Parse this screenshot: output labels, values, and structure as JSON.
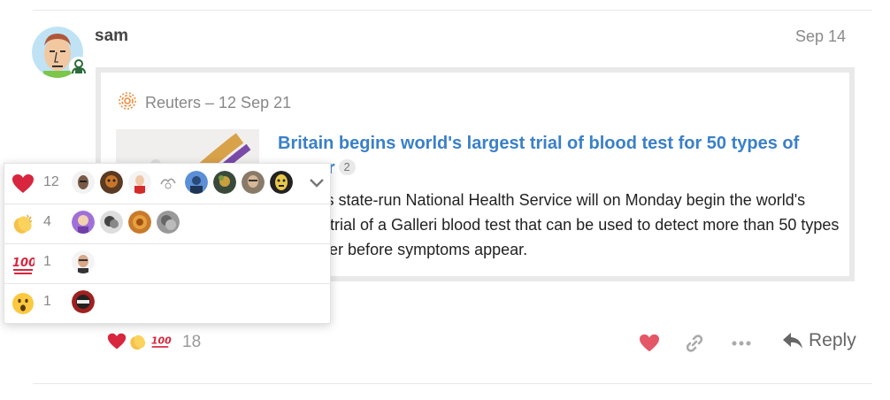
{
  "post": {
    "username": "sam",
    "date": "Sep 14"
  },
  "onebox": {
    "source": "Reuters – 12 Sep 21",
    "title": "Britain begins world's largest trial of blood test for 50 types of cancer",
    "link_count": "2",
    "excerpt": "Britain's state-run National Health Service will on Monday begin the world's largest trial of a Galleri blood test that can be used to detect more than 50 types of cancer before symptoms appear."
  },
  "reactions": [
    {
      "emoji": "heart",
      "count": "12",
      "users": [
        "u1",
        "u2",
        "u3",
        "u4",
        "u5",
        "u6",
        "u7",
        "u8"
      ]
    },
    {
      "emoji": "clap",
      "count": "4",
      "users": [
        "u9",
        "u10",
        "u11",
        "u12"
      ]
    },
    {
      "emoji": "100",
      "count": "1",
      "users": [
        "u13"
      ]
    },
    {
      "emoji": "open_mouth",
      "count": "1",
      "users": [
        "u14"
      ]
    }
  ],
  "summary": {
    "total": "18"
  },
  "controls": {
    "reply_label": "Reply"
  },
  "colors": {
    "link": "#3a80c8",
    "heart": "#e45767",
    "muted": "#888888"
  }
}
